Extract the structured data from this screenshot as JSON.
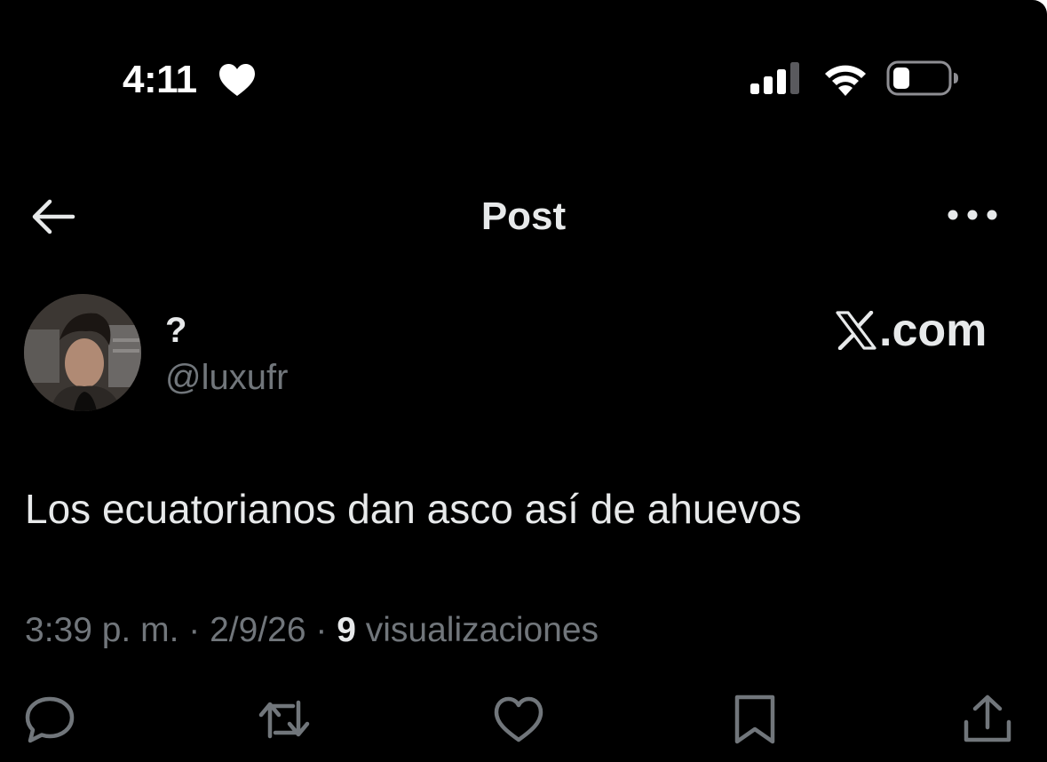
{
  "status_bar": {
    "time": "4:11",
    "icons": [
      "heart-icon",
      "signal-icon",
      "wifi-icon",
      "battery-icon"
    ]
  },
  "nav": {
    "title": "Post",
    "back_icon": "back-arrow-icon",
    "more_icon": "more-icon"
  },
  "author": {
    "display_name": "?",
    "handle": "@luxufr"
  },
  "brand": {
    "text": ".com",
    "icon": "x-logo-icon"
  },
  "post": {
    "text": "Los ecuatorianos dan asco así de ahuevos"
  },
  "meta": {
    "time": "3:39 p. m.",
    "separator": " · ",
    "date": "2/9/26",
    "views_count": "9",
    "views_label": " visualizaciones"
  },
  "actions": [
    "reply-icon",
    "repost-icon",
    "like-icon",
    "bookmark-icon",
    "share-icon"
  ],
  "colors": {
    "background": "#000000",
    "primary_text": "#e7e9ea",
    "secondary_text": "#71767b"
  }
}
